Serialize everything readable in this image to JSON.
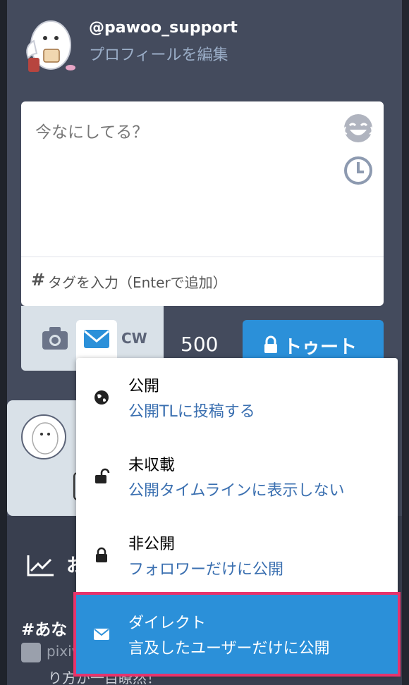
{
  "account": {
    "username": "@pawoo_support",
    "edit_profile_label": "プロフィールを編集"
  },
  "compose": {
    "placeholder": "今なにしてる？",
    "emoji_icon": "emoji-icon",
    "schedule_icon": "clock-icon",
    "tag_hash": "#",
    "tag_placeholder": "タグを入力（Enterで追加）",
    "cw_label": "CW",
    "char_count": "500",
    "toot_label": "トゥート"
  },
  "privacy_menu": {
    "items": [
      {
        "title": "公開",
        "desc": "公開TLに投稿する",
        "icon": "globe-icon"
      },
      {
        "title": "未収載",
        "desc": "公開タイムラインに表示しない",
        "icon": "unlock-icon"
      },
      {
        "title": "非公開",
        "desc": "フォロワーだけに公開",
        "icon": "lock-icon"
      },
      {
        "title": "ダイレクト",
        "desc": "言及したユーザーだけに公開",
        "icon": "envelope-icon",
        "selected": true
      }
    ]
  },
  "background": {
    "trend_partial": "お",
    "hashtag_partial": "#あな",
    "pixiv_partial": "pixiv",
    "cut_text": "り方が一目瞭然！"
  },
  "colors": {
    "accent": "#2b90d9",
    "highlight_border": "#e8336b",
    "panel_bg": "#444b5d"
  }
}
